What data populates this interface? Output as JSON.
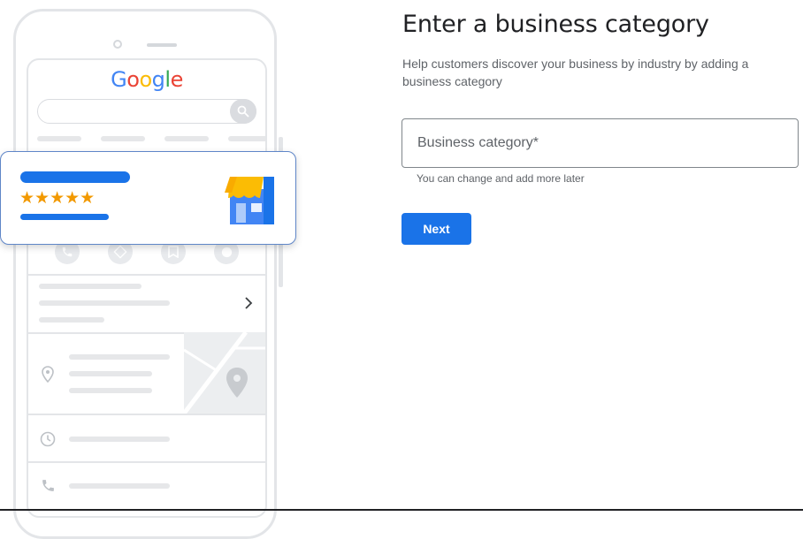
{
  "illustration": {
    "logo_letters": [
      {
        "char": "G",
        "color": "#4285F4"
      },
      {
        "char": "o",
        "color": "#EA4335"
      },
      {
        "char": "o",
        "color": "#FBBC05"
      },
      {
        "char": "g",
        "color": "#4285F4"
      },
      {
        "char": "l",
        "color": "#34A853"
      },
      {
        "char": "e",
        "color": "#EA4335"
      }
    ],
    "rating_stars": "★★★★★",
    "rating_value": 5,
    "action_icons": [
      "phone-icon",
      "directions-icon",
      "bookmark-icon",
      "globe-icon"
    ],
    "row_icons": [
      "chevron-right-icon",
      "location-pin-icon",
      "clock-icon",
      "phone-icon"
    ]
  },
  "form": {
    "title": "Enter a business category",
    "subtitle": "Help customers discover your business by industry by adding a business category",
    "field": {
      "placeholder": "Business category*",
      "value": ""
    },
    "helper_text": "You can change and add more later",
    "next_label": "Next"
  },
  "colors": {
    "accent": "#1a73e8",
    "star": "#f29900",
    "store_awning": "#fbbc04",
    "store_body": "#4285f4"
  }
}
